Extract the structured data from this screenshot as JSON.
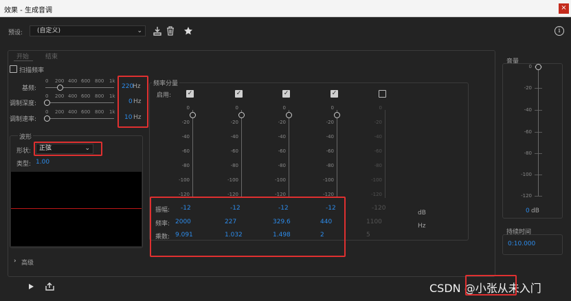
{
  "window": {
    "title": "效果 - 生成音调",
    "close": "×"
  },
  "toolbar": {
    "preset_label": "预设:",
    "preset_value": "(自定义)",
    "info": "i"
  },
  "tabs": [
    "开始",
    "结束"
  ],
  "sweep": {
    "label": "扫描频率",
    "checked": false
  },
  "base": {
    "label": "基频:",
    "value": "220",
    "unit": "Hz",
    "scale": [
      "0",
      "200",
      "400",
      "600",
      "800",
      "1k"
    ]
  },
  "moddepth": {
    "label": "调制深度:",
    "value": "0",
    "unit": "Hz",
    "scale": [
      "0",
      "200",
      "400",
      "600",
      "800",
      "1k"
    ]
  },
  "modrate": {
    "label": "调制速率:",
    "value": "10",
    "unit": "Hz",
    "scale": [
      "0",
      "200",
      "400",
      "600",
      "800",
      "1k"
    ]
  },
  "waveform": {
    "title": "波形",
    "shape_label": "形状:",
    "shape_value": "正弦",
    "type_label": "类型:",
    "type_value": "1.00"
  },
  "components": {
    "title": "频率分量",
    "enable_label": "启用:",
    "ticks": [
      "0",
      "-20",
      "-40",
      "-60",
      "-80",
      "-100",
      "-120"
    ],
    "columns": [
      {
        "enabled": true,
        "amp": "-12",
        "freq": "2000",
        "mult": "9.091",
        "ticks": [
          "0",
          "-20",
          "-40",
          "-60",
          "-80",
          "-100",
          "-120"
        ]
      },
      {
        "enabled": true,
        "amp": "-12",
        "freq": "227",
        "mult": "1.032",
        "ticks": [
          "0",
          "-20",
          "-40",
          "-60",
          "-80",
          "-100",
          "-120"
        ]
      },
      {
        "enabled": true,
        "amp": "-12",
        "freq": "329.6",
        "mult": "1.498",
        "ticks": [
          "0",
          "-20",
          "-40",
          "-60",
          "-80",
          "-100",
          "-120"
        ]
      },
      {
        "enabled": true,
        "amp": "-12",
        "freq": "440",
        "mult": "2",
        "ticks": [
          "0",
          "-20",
          "-40",
          "-60",
          "-80",
          "-100",
          "-120"
        ]
      },
      {
        "enabled": false,
        "amp": "-120",
        "freq": "1100",
        "mult": "5",
        "ticks": [
          "0",
          "-20",
          "-40",
          "-60",
          "-80",
          "-100",
          "-120"
        ]
      }
    ],
    "amp_label": "振幅:",
    "freq_label": "频率:",
    "mult_label": "乘数:",
    "db_unit": "dB",
    "hz_unit": "Hz"
  },
  "volume": {
    "title": "音量",
    "ticks": [
      "0",
      "-20",
      "-40",
      "-60",
      "-80",
      "-100",
      "-120"
    ],
    "value": "0",
    "unit": "dB"
  },
  "duration": {
    "title": "持续时间",
    "value": "0:10.000"
  },
  "advanced": {
    "label": "高级"
  },
  "watermark": "CSDN @小张从未入门",
  "colors": {
    "accent": "#2d8ceb",
    "highlight": "#e03030",
    "close": "#c42b1c"
  }
}
